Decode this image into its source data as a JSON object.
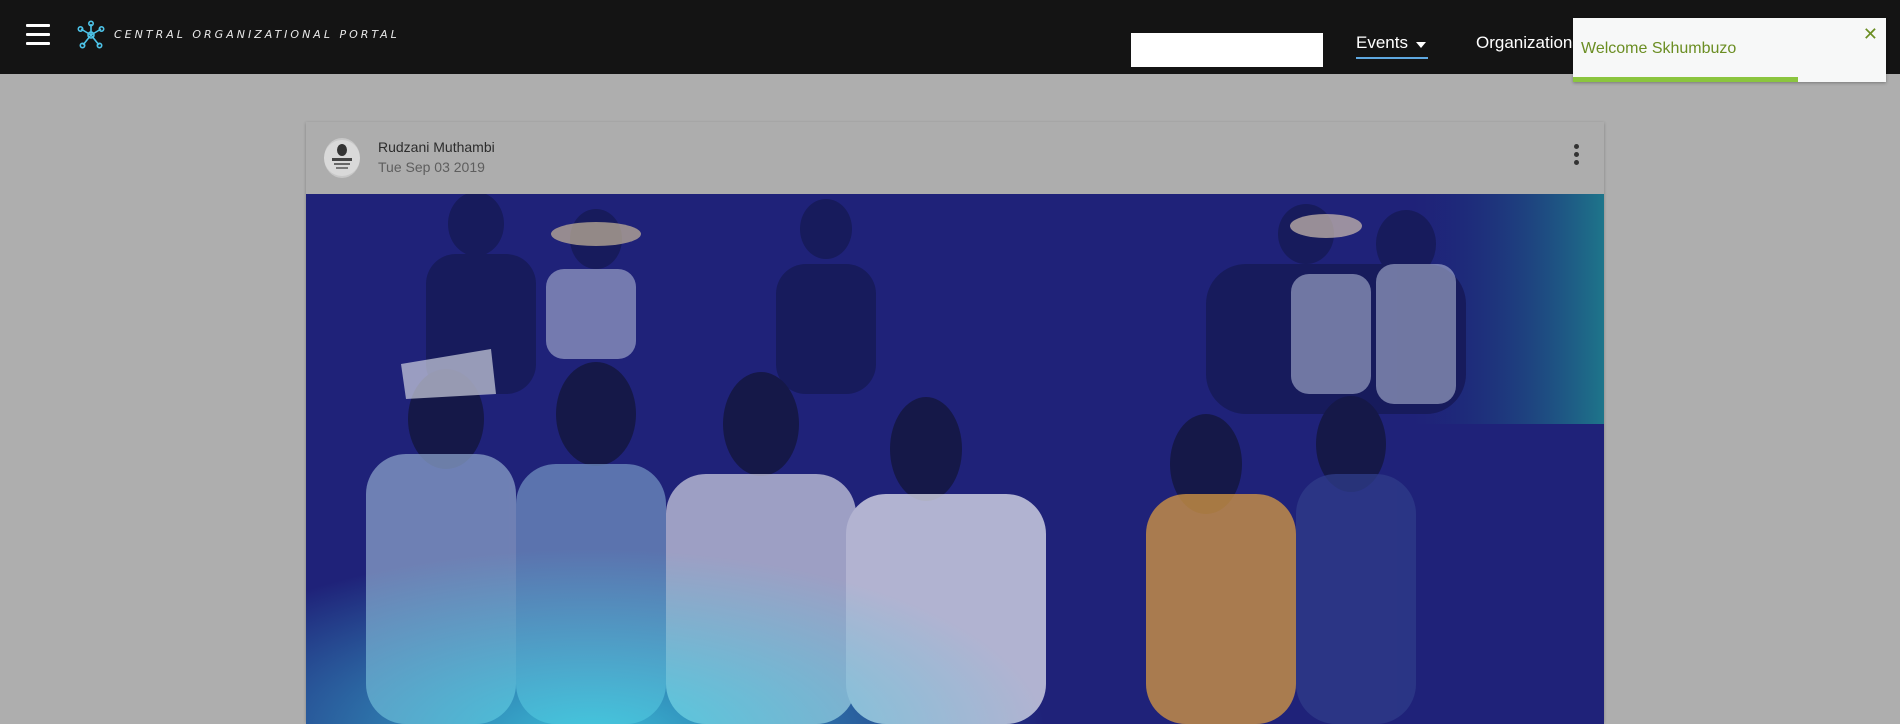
{
  "header": {
    "title": "CENTRAL ORGANIZATIONAL PORTAL",
    "menu_icon": "hamburger-icon",
    "logo_icon": "network-hub-icon",
    "search": {
      "value": "",
      "placeholder": ""
    },
    "nav": [
      {
        "label": "Events",
        "active": true,
        "has_dropdown": true
      },
      {
        "label": "Organizations"
      }
    ]
  },
  "toast": {
    "message": "Welcome Skhumbuzo",
    "close_icon": "close-icon",
    "progress": 0.72,
    "color": "#6b8e23",
    "progress_color": "#8bc53f"
  },
  "post": {
    "author": "Rudzani Muthambi",
    "date": "Tue Sep 03 2019",
    "more_icon": "more-vertical-icon",
    "image_subject": "group photo of people seated indoors"
  },
  "colors": {
    "topbar": "#141414",
    "overlay_bg": "#aeaeae",
    "accent": "#5fa8e0",
    "logo": "#4dc3e8"
  }
}
